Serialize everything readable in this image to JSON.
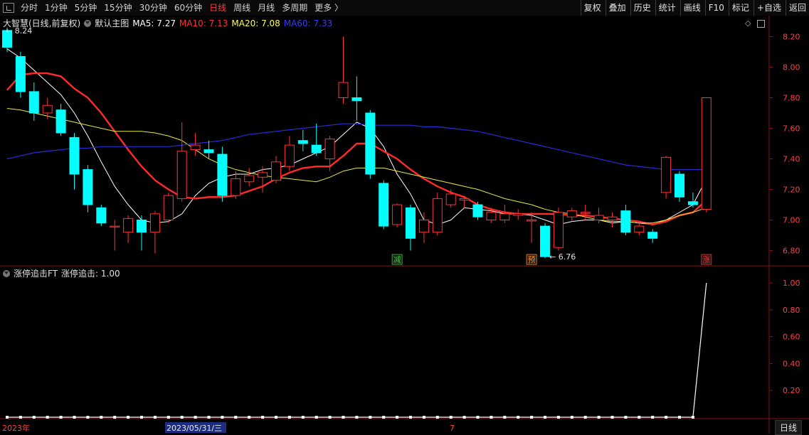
{
  "toolbar": {
    "periods": [
      "分时",
      "1分钟",
      "5分钟",
      "15分钟",
      "30分钟",
      "60分钟",
      "日线",
      "周线",
      "月线",
      "多周期",
      "更多 〉"
    ],
    "active_period": "日线",
    "actions": [
      "复权",
      "叠加",
      "历史",
      "统计",
      "画线",
      "F10",
      "标记",
      "+自选",
      "返回"
    ]
  },
  "main_legend": {
    "stock": "大智慧(日线,前复权)",
    "template": "默认主图",
    "ma": [
      {
        "label": "MA5: 7.27",
        "color": "#ffffff"
      },
      {
        "label": "MA10: 7.13",
        "color": "#ff3030"
      },
      {
        "label": "MA20: 7.08",
        "color": "#ffff40"
      },
      {
        "label": "MA60: 7.33",
        "color": "#3a3aff"
      }
    ]
  },
  "sub_legend": {
    "indicator": "涨停追击FT",
    "value_label": "涨停追击: 1.00"
  },
  "annotations": {
    "high": "8.24",
    "low": "6.76",
    "markers": [
      {
        "text": "减",
        "color": "#30d030",
        "candle": 29
      },
      {
        "text": "预",
        "color": "#ff9020",
        "candle": 39
      },
      {
        "text": "涨",
        "color": "#ff3030",
        "candle": 52
      }
    ]
  },
  "x_labels": {
    "year": "2023年",
    "cursor_date": "2023/05/31/三",
    "month": "7"
  },
  "bottom_tab": "日线",
  "colors": {
    "up": "#ff3232",
    "down": "#00ffff",
    "axis": "#8a1010",
    "axis_text": "#ff4040"
  },
  "chart_data": [
    {
      "type": "candlestick",
      "ylim": [
        6.7,
        8.3
      ],
      "y_ticks": [
        "8.20",
        "8.00",
        "7.80",
        "7.60",
        "7.40",
        "7.20",
        "7.00",
        "6.80"
      ],
      "candles": [
        [
          8.24,
          8.13,
          8.26,
          8.1
        ],
        [
          8.07,
          7.84,
          8.1,
          7.8
        ],
        [
          7.84,
          7.7,
          7.9,
          7.65
        ],
        [
          7.7,
          7.75,
          7.8,
          7.66
        ],
        [
          7.72,
          7.57,
          7.76,
          7.55
        ],
        [
          7.54,
          7.3,
          7.57,
          7.2
        ],
        [
          7.33,
          7.1,
          7.36,
          7.05
        ],
        [
          7.08,
          6.98,
          7.1,
          6.96
        ],
        [
          6.96,
          6.96,
          7.0,
          6.8
        ],
        [
          6.92,
          7.01,
          7.03,
          6.85
        ],
        [
          7.0,
          6.92,
          7.03,
          6.8
        ],
        [
          6.92,
          7.04,
          7.06,
          6.78
        ],
        [
          7.0,
          7.16,
          7.18,
          6.98
        ],
        [
          7.14,
          7.45,
          7.64,
          7.12
        ],
        [
          7.46,
          7.49,
          7.57,
          7.42
        ],
        [
          7.46,
          7.44,
          7.52,
          7.4
        ],
        [
          7.43,
          7.16,
          7.48,
          7.12
        ],
        [
          7.16,
          7.27,
          7.32,
          7.14
        ],
        [
          7.25,
          7.29,
          7.34,
          7.22
        ],
        [
          7.28,
          7.31,
          7.35,
          7.18
        ],
        [
          7.26,
          7.38,
          7.42,
          7.24
        ],
        [
          7.35,
          7.49,
          7.55,
          7.32
        ],
        [
          7.52,
          7.5,
          7.59,
          7.45
        ],
        [
          7.49,
          7.44,
          7.63,
          7.42
        ],
        [
          7.4,
          7.53,
          7.55,
          7.32
        ],
        [
          7.8,
          7.9,
          8.2,
          7.76
        ],
        [
          7.8,
          7.78,
          7.94,
          7.65
        ],
        [
          7.7,
          7.3,
          7.72,
          7.27
        ],
        [
          7.24,
          6.96,
          7.26,
          6.94
        ],
        [
          6.97,
          7.1,
          7.11,
          6.95
        ],
        [
          7.08,
          6.88,
          7.1,
          6.8
        ],
        [
          6.92,
          7.0,
          7.05,
          6.85
        ],
        [
          6.92,
          7.14,
          7.18,
          6.9
        ],
        [
          7.1,
          7.17,
          7.2,
          7.08
        ],
        [
          7.13,
          7.14,
          7.16,
          7.08
        ],
        [
          7.1,
          7.02,
          7.12,
          7.0
        ],
        [
          7.0,
          7.05,
          7.08,
          6.98
        ],
        [
          7.0,
          7.04,
          7.1,
          6.98
        ],
        [
          7.03,
          7.04,
          7.07,
          7.0
        ],
        [
          7.0,
          7.0,
          7.05,
          6.85
        ],
        [
          6.96,
          6.76,
          6.98,
          6.75
        ],
        [
          6.82,
          7.05,
          7.08,
          6.8
        ],
        [
          7.02,
          7.06,
          7.08,
          6.99
        ],
        [
          7.05,
          7.05,
          7.1,
          7.0
        ],
        [
          7.0,
          7.03,
          7.08,
          6.98
        ],
        [
          7.0,
          7.02,
          7.05,
          6.95
        ],
        [
          7.06,
          6.92,
          7.1,
          6.9
        ],
        [
          6.92,
          6.96,
          6.98,
          6.9
        ],
        [
          6.92,
          6.88,
          6.94,
          6.85
        ],
        [
          7.18,
          7.41,
          7.42,
          7.14
        ],
        [
          7.3,
          7.15,
          7.32,
          7.12
        ],
        [
          7.12,
          7.1,
          7.18,
          7.08
        ],
        [
          7.07,
          7.8,
          7.8,
          7.05
        ]
      ],
      "ma_series": [
        {
          "name": "MA5",
          "values": [
            8.12,
            8.06,
            7.98,
            7.9,
            7.82,
            7.7,
            7.55,
            7.38,
            7.22,
            7.1,
            7.0,
            6.98,
            6.99,
            7.04,
            7.16,
            7.24,
            7.28,
            7.3,
            7.3,
            7.33,
            7.34,
            7.36,
            7.4,
            7.44,
            7.48,
            7.56,
            7.64,
            7.6,
            7.48,
            7.3,
            7.17,
            7.0,
            6.97,
            7.0,
            7.08,
            7.07,
            7.06,
            7.04,
            7.04,
            7.03,
            7.0,
            6.97,
            6.99,
            7.0,
            7.0,
            6.98,
            6.99,
            6.98,
            6.97,
            7.0,
            7.05,
            7.1,
            7.27
          ]
        },
        {
          "name": "MA10",
          "values": [
            7.85,
            7.95,
            7.96,
            7.96,
            7.94,
            7.86,
            7.8,
            7.7,
            7.58,
            7.46,
            7.35,
            7.26,
            7.2,
            7.15,
            7.14,
            7.15,
            7.15,
            7.16,
            7.19,
            7.22,
            7.27,
            7.31,
            7.34,
            7.35,
            7.35,
            7.42,
            7.5,
            7.5,
            7.45,
            7.4,
            7.33,
            7.27,
            7.22,
            7.18,
            7.15,
            7.1,
            7.07,
            7.05,
            7.04,
            7.04,
            7.04,
            7.04,
            7.03,
            7.03,
            7.02,
            7.01,
            7.0,
            6.99,
            6.97,
            6.99,
            7.03,
            7.05,
            7.13
          ]
        },
        {
          "name": "MA20",
          "values": [
            7.73,
            7.72,
            7.7,
            7.68,
            7.66,
            7.64,
            7.62,
            7.6,
            7.58,
            7.58,
            7.58,
            7.57,
            7.55,
            7.52,
            7.46,
            7.4,
            7.36,
            7.33,
            7.31,
            7.29,
            7.28,
            7.27,
            7.26,
            7.25,
            7.28,
            7.32,
            7.34,
            7.34,
            7.34,
            7.32,
            7.3,
            7.28,
            7.26,
            7.24,
            7.22,
            7.2,
            7.17,
            7.14,
            7.12,
            7.1,
            7.07,
            7.05,
            7.04,
            7.02,
            7.0,
            6.99,
            6.99,
            6.98,
            6.98,
            7.0,
            7.03,
            7.05,
            7.08
          ]
        },
        {
          "name": "MA60",
          "values": [
            7.4,
            7.42,
            7.44,
            7.45,
            7.46,
            7.47,
            7.47,
            7.48,
            7.48,
            7.48,
            7.48,
            7.48,
            7.48,
            7.49,
            7.5,
            7.51,
            7.52,
            7.54,
            7.56,
            7.57,
            7.58,
            7.59,
            7.6,
            7.61,
            7.62,
            7.63,
            7.63,
            7.62,
            7.62,
            7.62,
            7.62,
            7.61,
            7.61,
            7.6,
            7.59,
            7.58,
            7.56,
            7.54,
            7.52,
            7.5,
            7.48,
            7.46,
            7.44,
            7.42,
            7.4,
            7.38,
            7.36,
            7.35,
            7.34,
            7.33,
            7.33,
            7.33,
            7.33
          ]
        }
      ]
    },
    {
      "type": "line",
      "name": "涨停追击",
      "ylim": [
        0,
        1.08
      ],
      "y_ticks": [
        "1.00",
        "0.80",
        "0.60",
        "0.40",
        "0.20"
      ],
      "values": [
        0,
        0,
        0,
        0,
        0,
        0,
        0,
        0,
        0,
        0,
        0,
        0,
        0,
        0,
        0,
        0,
        0,
        0,
        0,
        0,
        0,
        0,
        0,
        0,
        0,
        0,
        0,
        0,
        0,
        0,
        0,
        0,
        0,
        0,
        0,
        0,
        0,
        0,
        0,
        0,
        0,
        0,
        0,
        0,
        0,
        0,
        0,
        0,
        0,
        0,
        0,
        0,
        1
      ]
    }
  ]
}
